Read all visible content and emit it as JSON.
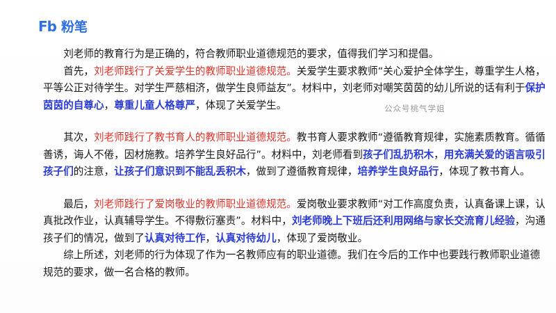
{
  "brand": {
    "logo_mark": "Fb",
    "name": "粉笔"
  },
  "watermark": "公众号桃气学姐",
  "paragraphs": {
    "intro": "刘老师的教育行为是正确的，符合教师职业道德规范的要求，值得我们学习和提倡。",
    "p1": {
      "lead": "首先，",
      "highlight": "刘老师践行了关爱学生的教师职业道德规范。",
      "t1": "关爱学生要求教师“关心爱护全体学生，尊重学生人格，平等公正对待学生。对学生严慈相济，做学生良师益友”。材料中，刘老师对嘲笑茵茵的幼儿所说的话有利于",
      "b1": "保护茵茵的自尊心",
      "t2": "，",
      "b2": "尊重儿童人格尊严",
      "t3": "，体现了关爱学生。"
    },
    "p2": {
      "lead": "其次，",
      "highlight": "刘老师践行了教书育人的教师职业道德规范。",
      "t1": "教书育人要求教师“遵循教育规律，实施素质教育。循循善诱，诲人不倦，因材施教。培养学生良好品行”。材料中，刘老师看到",
      "b1": "孩子们乱扔积木",
      "t2": "，",
      "b2": "用充满关爱的语言吸引孩子们",
      "t3": "的注意，",
      "b3": "让孩子们意识到不能乱丢积木",
      "t4": "，做到了遵循教育规律，",
      "b4": "培养学生良好品行",
      "t5": "，体现了教书育人。"
    },
    "p3": {
      "lead": "最后，",
      "highlight": "刘老师践行了爱岗敬业的教师职业道德规范。",
      "t1": "爱岗敬业要求教师“对工作高度负责，认真备课上课，认真批改作业，认真辅导学生。不得敷衍塞责”。材料中，",
      "b1": "刘老师晚上下班后还利用网络与家长交流育儿经验",
      "t2": "，沟通孩子们的情况，做到了",
      "b2": "认真对待工作",
      "t3": "，",
      "b3": "认真对待幼儿",
      "t4": "，体现了爱岗敬业。"
    },
    "conclusion": "综上所述，刘老师的行为体现了作为一名教师应有的职业道德。我们在今后的工作中也要践行教师职业道德规范的要求，做一名合格的教师。"
  },
  "colors": {
    "brand": "#2f6fe4",
    "highlight_red": "#e0342b",
    "emphasis_blue": "#2b3bd6"
  }
}
